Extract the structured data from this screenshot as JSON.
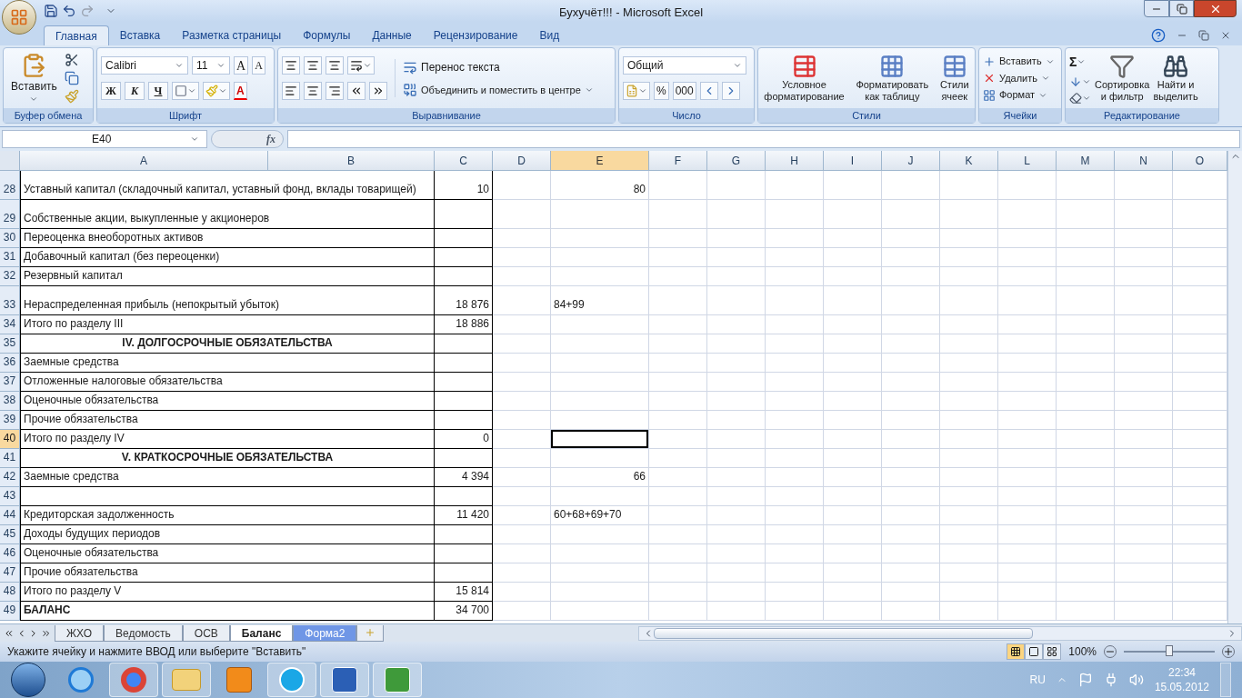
{
  "window": {
    "title": "Бухучёт!!! - Microsoft Excel"
  },
  "ribbon_tabs": [
    {
      "label": "Главная",
      "selected": true
    },
    {
      "label": "Вставка",
      "selected": false
    },
    {
      "label": "Разметка страницы",
      "selected": false
    },
    {
      "label": "Формулы",
      "selected": false
    },
    {
      "label": "Данные",
      "selected": false
    },
    {
      "label": "Рецензирование",
      "selected": false
    },
    {
      "label": "Вид",
      "selected": false
    }
  ],
  "ribbon": {
    "clipboard": {
      "paste": "Вставить",
      "label": "Буфер обмена"
    },
    "font": {
      "name": "Calibri",
      "size": "11",
      "grow": "A",
      "shrink": "A",
      "bold": "Ж",
      "italic": "К",
      "underline": "Ч",
      "color_letter": "A",
      "label": "Шрифт"
    },
    "alignment": {
      "wrap": "Перенос текста",
      "merge": "Объединить и поместить в центре",
      "label": "Выравнивание"
    },
    "number": {
      "format": "Общий",
      "percent": "%",
      "thousands": "000",
      "label": "Число"
    },
    "styles": {
      "buttons": [
        {
          "kind": "conditional",
          "lines": [
            "Условное",
            "форматирование"
          ]
        },
        {
          "kind": "table",
          "lines": [
            "Форматировать",
            "как таблицу"
          ]
        },
        {
          "kind": "cell",
          "lines": [
            "Стили",
            "ячеек"
          ]
        }
      ],
      "label": "Стили"
    },
    "cells": {
      "buttons": [
        {
          "kind": "insert",
          "label": "Вставить"
        },
        {
          "kind": "delete",
          "label": "Удалить"
        },
        {
          "kind": "format",
          "label": "Формат"
        }
      ],
      "label": "Ячейки"
    },
    "editing": {
      "sum": "Σ",
      "buttons": [
        {
          "kind": "sort",
          "lines": [
            "Сортировка",
            "и фильтр"
          ]
        },
        {
          "kind": "find",
          "lines": [
            "Найти и",
            "выделить"
          ]
        }
      ],
      "label": "Редактирование"
    }
  },
  "formula_bar": {
    "name_box": "E40",
    "fx": "fx"
  },
  "sheet": {
    "columns": [
      {
        "label": "A",
        "selected": false
      },
      {
        "label": "B",
        "selected": false
      },
      {
        "label": "C",
        "selected": false
      },
      {
        "label": "D",
        "selected": false
      },
      {
        "label": "E",
        "selected": true
      },
      {
        "label": "F",
        "selected": false
      },
      {
        "label": "G",
        "selected": false
      },
      {
        "label": "H",
        "selected": false
      },
      {
        "label": "I",
        "selected": false
      },
      {
        "label": "J",
        "selected": false
      },
      {
        "label": "K",
        "selected": false
      },
      {
        "label": "L",
        "selected": false
      },
      {
        "label": "M",
        "selected": false
      },
      {
        "label": "N",
        "selected": false
      },
      {
        "label": "O",
        "selected": false
      }
    ],
    "rows": [
      {
        "number": "28",
        "kind": "item",
        "a": "Уставный капитал (складочный капитал, уставный фонд, вклады товарищей)",
        "c": "10",
        "e": {
          "value": "80",
          "kind": "number"
        },
        "selected": false
      },
      {
        "number": "29",
        "kind": "item",
        "a": "Собственные акции, выкупленные у акционеров",
        "selected": false
      },
      {
        "number": "30",
        "kind": "item",
        "a": "Переоценка внеоборотных активов",
        "selected": false
      },
      {
        "number": "31",
        "kind": "item",
        "a": "Добавочный капитал (без переоценки)",
        "selected": false
      },
      {
        "number": "32",
        "kind": "item",
        "a": "Резервный капитал",
        "selected": false
      },
      {
        "number": "33",
        "kind": "item",
        "a": "Нераспределенная прибыль (непокрытый убыток)",
        "c": "18 876",
        "e": {
          "value": "84+99",
          "kind": "text"
        },
        "selected": false
      },
      {
        "number": "34",
        "kind": "item",
        "a": "Итого по разделу III",
        "c": "18 886",
        "selected": false
      },
      {
        "number": "35",
        "kind": "section",
        "a": "IV. ДОЛГОСРОЧНЫЕ ОБЯЗАТЕЛЬСТВА",
        "selected": false
      },
      {
        "number": "36",
        "kind": "item",
        "a": "Заемные средства",
        "selected": false
      },
      {
        "number": "37",
        "kind": "item",
        "a": "Отложенные налоговые обязательства",
        "selected": false
      },
      {
        "number": "38",
        "kind": "item",
        "a": "Оценочные обязательства",
        "selected": false
      },
      {
        "number": "39",
        "kind": "item",
        "a": "Прочие обязательства",
        "selected": false
      },
      {
        "number": "40",
        "kind": "item",
        "a": "Итого по разделу IV",
        "c": "0",
        "selected": true
      },
      {
        "number": "41",
        "kind": "section",
        "a": "V. КРАТКОСРОЧНЫЕ ОБЯЗАТЕЛЬСТВА",
        "selected": false
      },
      {
        "number": "42",
        "kind": "item",
        "a": "Заемные средства",
        "c": "4 394",
        "e": {
          "value": "66",
          "kind": "number"
        },
        "selected": false
      },
      {
        "number": "43",
        "kind": "item",
        "selected": false
      },
      {
        "number": "44",
        "kind": "item",
        "a": "Кредиторская задолженность",
        "c": "11 420",
        "e": {
          "value": "60+68+69+70",
          "kind": "text"
        },
        "selected": false
      },
      {
        "number": "45",
        "kind": "item",
        "a": "Доходы будущих периодов",
        "selected": false
      },
      {
        "number": "46",
        "kind": "item",
        "a": "Оценочные обязательства",
        "selected": false
      },
      {
        "number": "47",
        "kind": "item",
        "a": "Прочие обязательства",
        "selected": false
      },
      {
        "number": "48",
        "kind": "item",
        "a": "Итого по разделу V",
        "c": "15 814",
        "selected": false
      },
      {
        "number": "49",
        "kind": "total",
        "a": "БАЛАНС",
        "c": "34 700",
        "selected": false
      }
    ]
  },
  "sheet_tabs": [
    {
      "label": "ЖХО",
      "selected": false
    },
    {
      "label": "Ведомость",
      "selected": false
    },
    {
      "label": "ОСВ",
      "selected": false
    },
    {
      "label": "Баланс",
      "selected": true
    },
    {
      "label": "Форма2",
      "selected": false,
      "color": "#6f96e6"
    }
  ],
  "status_bar": {
    "message": "Укажите ячейку и нажмите ВВОД или выберите \"Вставить\"",
    "view_buttons": [
      {
        "kind": "normal",
        "selected": true
      },
      {
        "kind": "page_layout",
        "selected": false
      },
      {
        "kind": "page_break",
        "selected": false
      }
    ],
    "zoom": "100%",
    "zoom_slider": {
      "level": 0.5
    }
  },
  "taskbar": {
    "apps": [
      {
        "kind": "ie",
        "running": false
      },
      {
        "kind": "chrome",
        "running": true
      },
      {
        "kind": "folder",
        "running": true
      },
      {
        "kind": "media",
        "running": false
      },
      {
        "kind": "skype",
        "running": true
      },
      {
        "kind": "word",
        "running": true
      },
      {
        "kind": "excel",
        "running": true
      }
    ],
    "language": "RU",
    "time": "22:34",
    "date": "15.05.2012"
  }
}
